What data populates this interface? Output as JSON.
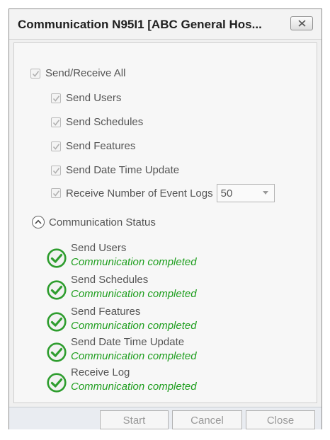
{
  "window": {
    "title": "Communication N95I1 [ABC General Hos..."
  },
  "options": {
    "send_receive_all": {
      "label": "Send/Receive All",
      "checked": true
    },
    "items": [
      {
        "label": "Send Users",
        "checked": true
      },
      {
        "label": "Send Schedules",
        "checked": true
      },
      {
        "label": "Send Features",
        "checked": true
      },
      {
        "label": "Send Date Time Update",
        "checked": true
      },
      {
        "label": "Receive Number of Event Logs",
        "checked": true
      }
    ],
    "event_logs_value": "50"
  },
  "status": {
    "header": "Communication Status",
    "items": [
      {
        "name": "Send Users",
        "message": "Communication completed"
      },
      {
        "name": "Send Schedules",
        "message": "Communication completed"
      },
      {
        "name": "Send Features",
        "message": "Communication completed"
      },
      {
        "name": "Send Date Time Update",
        "message": "Communication completed"
      },
      {
        "name": "Receive Log",
        "message": "Communication completed"
      }
    ]
  },
  "buttons": {
    "start": "Start",
    "cancel": "Cancel",
    "close": "Close"
  },
  "icons": {
    "close": "close-icon",
    "check": "check-icon",
    "collapse": "chevron-up-icon",
    "success": "success-check-icon",
    "dropdown": "triangle-down-icon"
  },
  "colors": {
    "success": "#1e9e1e",
    "footer": "#e9ecf1",
    "disabled_text": "#999999"
  }
}
